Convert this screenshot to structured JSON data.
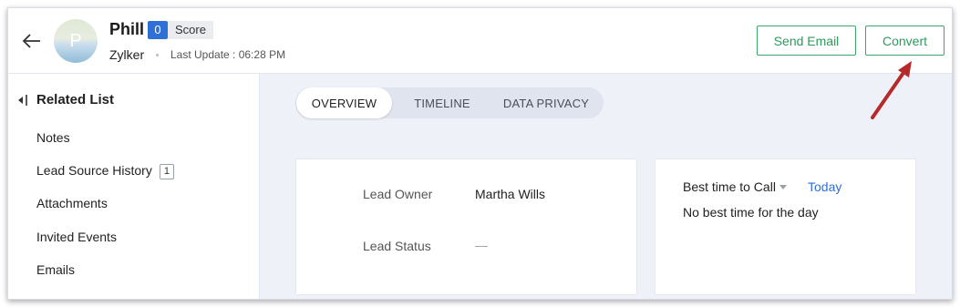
{
  "header": {
    "avatar_initial": "P",
    "lead_name": "Phill",
    "score_count": "0",
    "score_label": "Score",
    "company": "Zylker",
    "last_update": "Last Update : 06:28 PM",
    "send_email_label": "Send Email",
    "convert_label": "Convert"
  },
  "sidebar": {
    "title": "Related List",
    "items": [
      {
        "label": "Notes",
        "count": ""
      },
      {
        "label": "Lead Source History",
        "count": "1"
      },
      {
        "label": "Attachments",
        "count": ""
      },
      {
        "label": "Invited Events",
        "count": ""
      },
      {
        "label": "Emails",
        "count": ""
      }
    ]
  },
  "tabs": [
    {
      "label": "OVERVIEW",
      "active": true
    },
    {
      "label": "TIMELINE",
      "active": false
    },
    {
      "label": "DATA PRIVACY",
      "active": false
    }
  ],
  "lead_info": {
    "owner_label": "Lead Owner",
    "owner_value": "Martha Wills",
    "status_label": "Lead Status",
    "status_value": "—"
  },
  "best_time": {
    "label": "Best time to Call",
    "today_link": "Today",
    "message": "No best time for the day"
  },
  "colors": {
    "accent_green": "#39a86a",
    "score_blue": "#2f6fd6",
    "link_blue": "#2f6fd6",
    "annotation_arrow": "#b52a2a"
  },
  "icons": {
    "back": "back-arrow-icon",
    "collapse": "collapse-panel-icon",
    "dropdown": "caret-down-icon"
  }
}
